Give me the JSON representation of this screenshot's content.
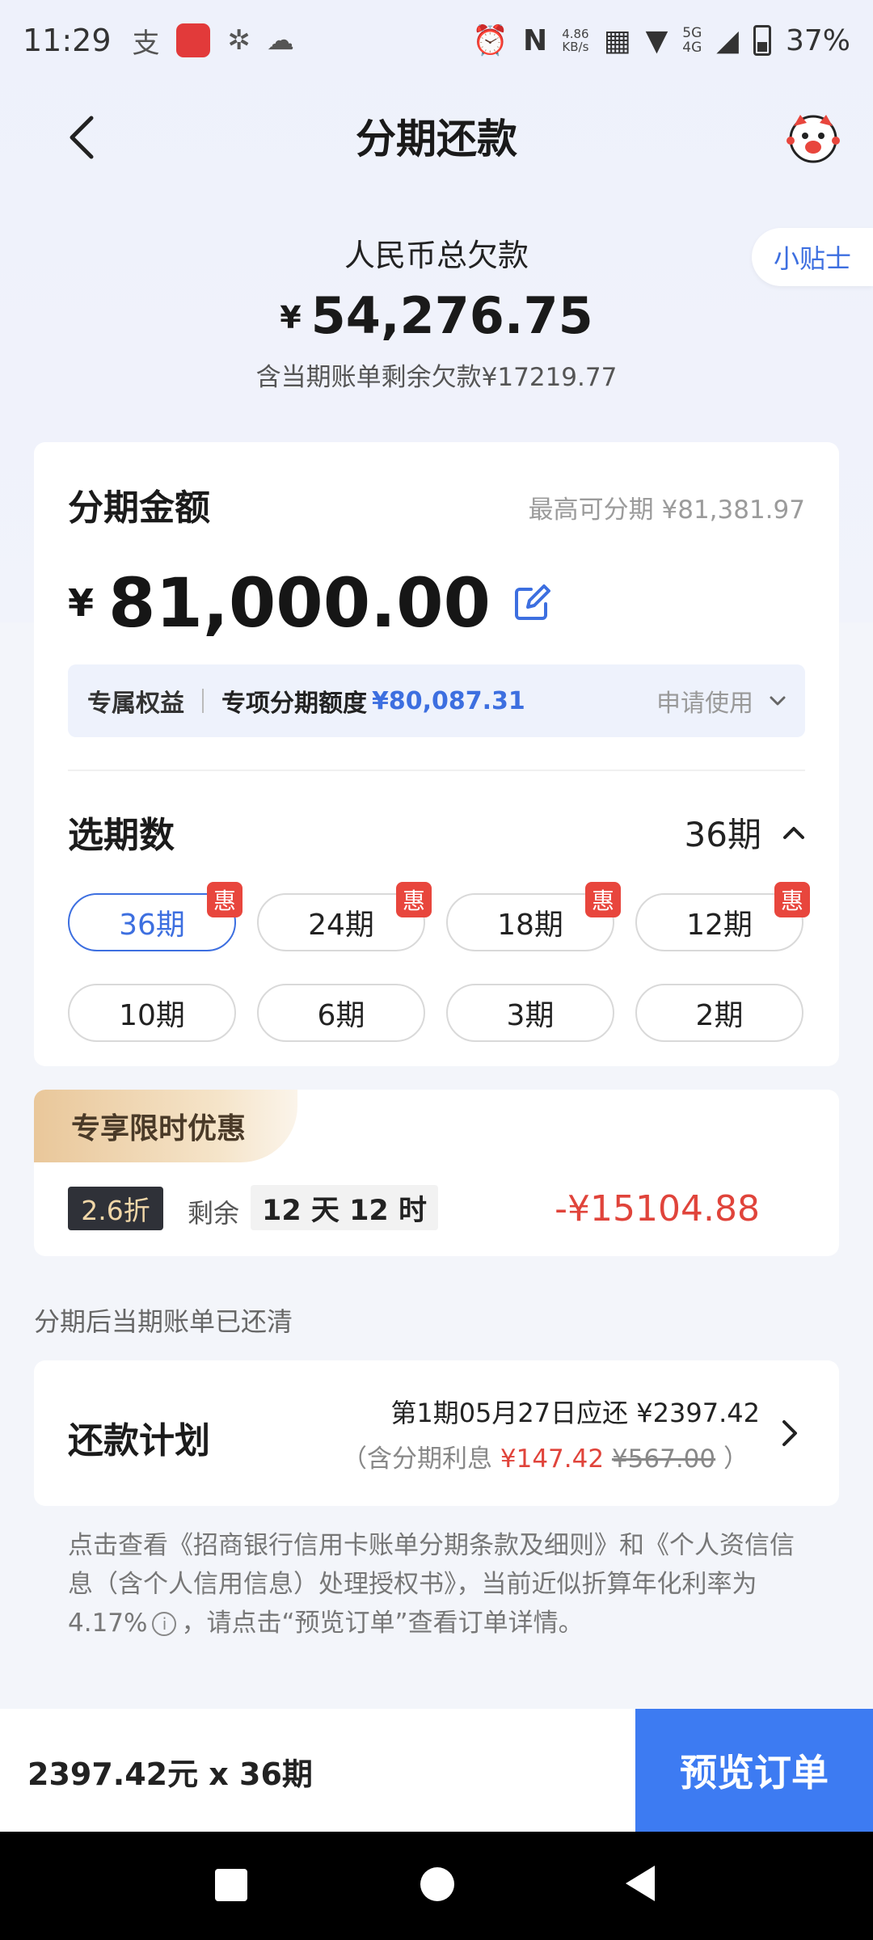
{
  "status_bar": {
    "time": "11:29",
    "speed_value": "4.86",
    "speed_unit": "KB/s",
    "network_top": "5G",
    "network_bottom": "4G",
    "battery": "37%"
  },
  "header": {
    "title": "分期还款"
  },
  "summary": {
    "label": "人民币总欠款",
    "currency": "¥",
    "amount": "54,276.75",
    "note": "含当期账单剩余欠款¥17219.77",
    "tips_label": "小贴士"
  },
  "installment": {
    "title": "分期金额",
    "max_note": "最高可分期 ¥81,381.97",
    "currency": "¥",
    "amount": "81,000.00",
    "benefit_tag": "专属权益",
    "benefit_label": "专项分期额度",
    "benefit_value": "¥80,087.31",
    "apply_label": "申请使用"
  },
  "terms": {
    "title": "选期数",
    "selected": "36期",
    "options": [
      {
        "label": "36期",
        "badge": "惠"
      },
      {
        "label": "24期",
        "badge": "惠"
      },
      {
        "label": "18期",
        "badge": "惠"
      },
      {
        "label": "12期",
        "badge": "惠"
      },
      {
        "label": "10期"
      },
      {
        "label": "6期"
      },
      {
        "label": "3期"
      },
      {
        "label": "2期"
      }
    ]
  },
  "promo": {
    "tag": "专享限时优惠",
    "discount": "2.6折",
    "remain_label": "剩余",
    "remain_time": "12 天 12 时",
    "saving": "-¥15104.88"
  },
  "cleared_note": "分期后当期账单已还清",
  "plan": {
    "title": "还款计划",
    "line1": "第1期05月27日应还 ¥2397.42",
    "line2_prefix": "（含分期利息 ",
    "interest": "¥147.42",
    "original_interest": "¥567.00",
    "line2_suffix": " ）"
  },
  "terms_text": {
    "part1": "点击查看《招商银行信用卡账单分期条款及细则》和《个人资信信息（含个人信用信息）处理授权书》，当前近似折算年化利率为4.17%",
    "part2": "，请点击“预览订单”查看订单详情。"
  },
  "bottom": {
    "summary": "2397.42元 x 36期",
    "preview_button": "预览订单"
  },
  "colors": {
    "accent": "#3d7bf2",
    "link_blue": "#3d6fe0",
    "red": "#e0443b"
  }
}
